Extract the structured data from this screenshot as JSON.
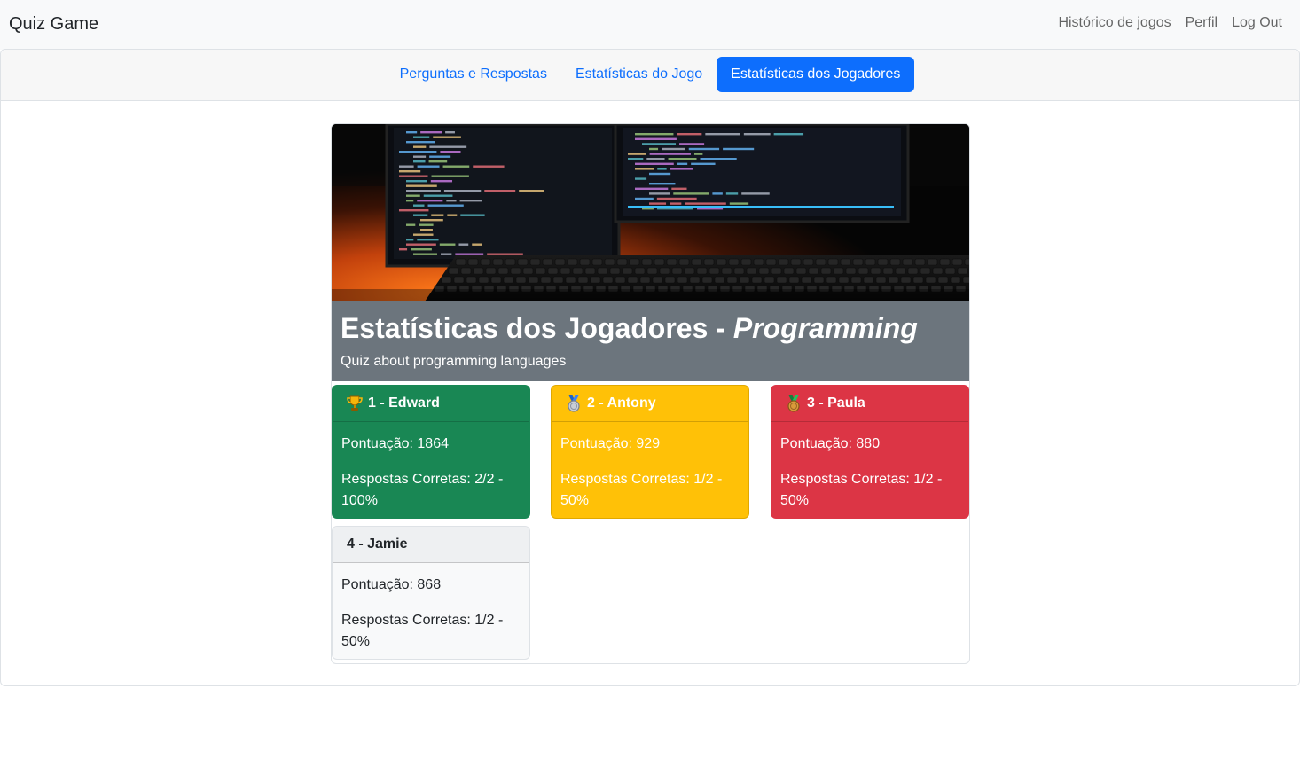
{
  "navbar": {
    "brand": "Quiz Game",
    "links": [
      "Histórico de jogos",
      "Perfil",
      "Log Out"
    ]
  },
  "tabs": [
    {
      "label": "Perguntas e Respostas",
      "active": false
    },
    {
      "label": "Estatísticas do Jogo",
      "active": false
    },
    {
      "label": "Estatísticas dos Jogadores",
      "active": true
    }
  ],
  "header": {
    "title_prefix": "Estatísticas dos Jogadores - ",
    "title_quiz": "Programming",
    "subtitle": "Quiz about programming languages"
  },
  "players": [
    {
      "rank_label": "1 - Edward",
      "score": "Pontuação: 1864",
      "correct": "Respostas Corretas: 2/2 - 100%",
      "medal": "trophy-icon",
      "color": "#198754"
    },
    {
      "rank_label": "2 - Antony",
      "score": "Pontuação: 929",
      "correct": "Respostas Corretas: 1/2 - 50%",
      "medal": "silver-medal-icon",
      "color": "#ffc107"
    },
    {
      "rank_label": "3 - Paula",
      "score": "Pontuação: 880",
      "correct": "Respostas Corretas: 1/2 - 50%",
      "medal": "bronze-medal-icon",
      "color": "#dc3545"
    },
    {
      "rank_label": "4 - Jamie",
      "score": "Pontuação: 868",
      "correct": "Respostas Corretas: 1/2 - 50%",
      "medal": "",
      "color": "#f8f9fa"
    }
  ]
}
